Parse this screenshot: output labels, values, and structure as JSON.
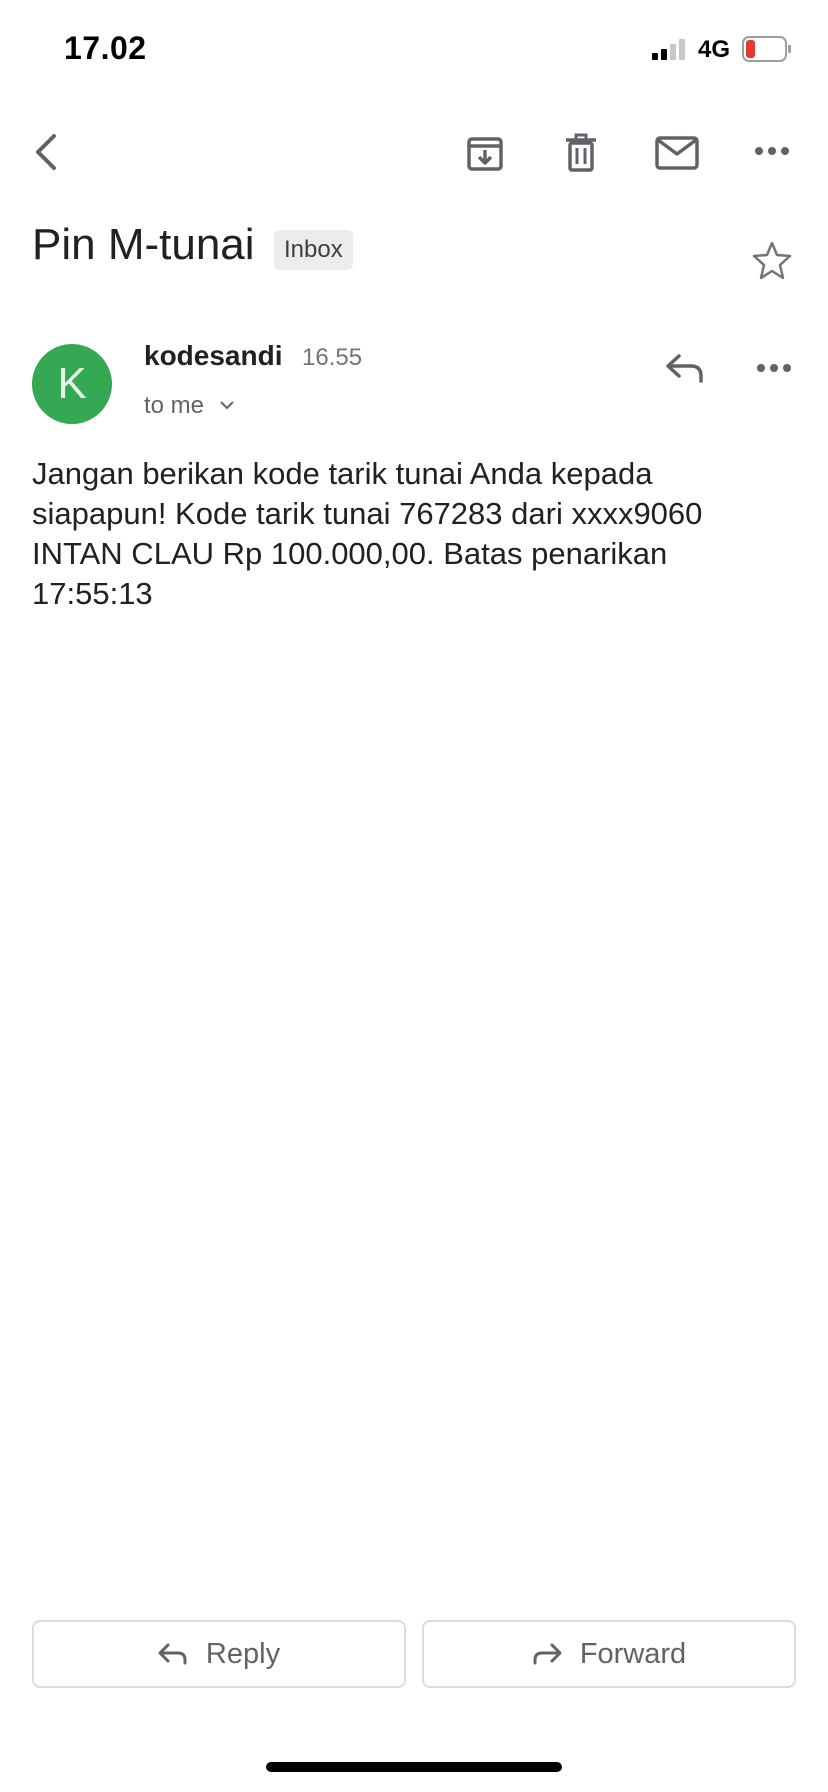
{
  "status_bar": {
    "time": "17.02",
    "network": "4G"
  },
  "toolbar": {
    "icons": [
      "back-icon",
      "archive-icon",
      "trash-icon",
      "mail-icon",
      "more-icon"
    ]
  },
  "email": {
    "subject": "Pin M-tunai",
    "label": "Inbox",
    "sender": "kodesandi",
    "sender_initial": "K",
    "avatar_color": "#34a853",
    "time": "16.55",
    "recipient": "to me",
    "body": "Jangan berikan kode tarik tunai Anda kepada siapapun! Kode tarik tunai 767283 dari xxxx9060 INTAN CLAU Rp 100.000,00. Batas penarikan 17:55:13"
  },
  "actions": {
    "reply_label": "Reply",
    "forward_label": "Forward"
  },
  "colors": {
    "battery_low": "#e53935",
    "text_primary": "#202124",
    "text_secondary": "#5f6368"
  }
}
